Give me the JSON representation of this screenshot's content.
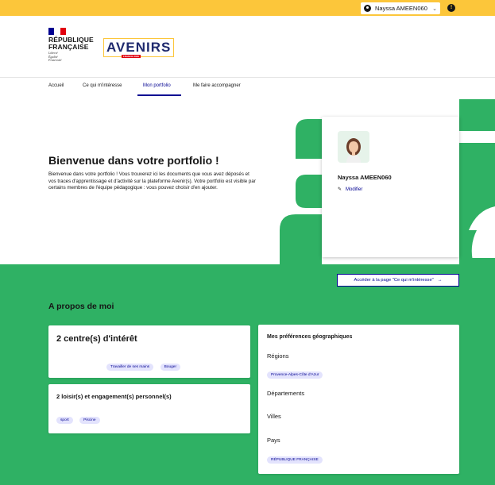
{
  "topbar": {
    "user_name": "Nayssa AMEEN060",
    "chevron": "⌄",
    "alert_glyph": "!"
  },
  "header": {
    "gov_name_line1": "RÉPUBLIQUE",
    "gov_name_line2": "FRANÇAISE",
    "motto_line1": "Liberté",
    "motto_line2": "Égalité",
    "motto_line3": "Fraternité",
    "logo_text": "AVENIRS",
    "logo_badge": "FRANCE 2030"
  },
  "nav": {
    "items": [
      {
        "label": "Accueil"
      },
      {
        "label": "Ce qui m'intéresse"
      },
      {
        "label": "Mon portfolio"
      },
      {
        "label": "Me faire accompagner"
      }
    ]
  },
  "hero": {
    "title": "Bienvenue dans votre portfolio !",
    "text": "Bienvenue dans votre portfolio ! Vous trouverez ici les documents que vous avez déposés et vos traces d'apprentissage et d'activité sur la plateforme Avenir(s). Votre portfolio est visible par certains membres de l'équipe pédagogique : vous pouvez choisir d'en ajouter."
  },
  "profile": {
    "name": "Nayssa AMEEN060",
    "modify_label": "Modifier"
  },
  "cta": {
    "label": "Accéder à la page \"Ce qui m'intéresse\"",
    "arrow": "→"
  },
  "about": {
    "title": "A propos de moi",
    "interests": {
      "title": "2 centre(s) d'intérêt",
      "tags": [
        "Travailler de ses mains",
        "Bouger"
      ]
    },
    "hobbies": {
      "title": "2 loisir(s) et engagement(s) personnel(s)",
      "tags": [
        "sport",
        "Piscine"
      ]
    },
    "geo": {
      "title": "Mes préférences géographiques",
      "regions_label": "Régions",
      "regions_tag": "Provence-Alpes-Côte d'Azur",
      "departments_label": "Départements",
      "cities_label": "Villes",
      "country_label": "Pays",
      "country_tag": "RÉPUBLIQUE FRANÇAISE"
    }
  },
  "colors": {
    "accent_blue": "#000091",
    "yellow": "#fcc63a",
    "green": "#2fb164",
    "tag_bg": "#e3e3fd"
  }
}
